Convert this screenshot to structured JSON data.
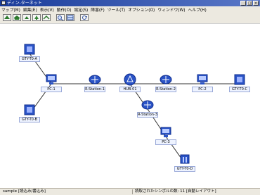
{
  "window": {
    "title": "ディン-ターネット"
  },
  "menu": [
    "マップ(M)",
    "編集(E)",
    "表示(V)",
    "動作(O)",
    "設定(S)",
    "障害(F)",
    "ツール(T)",
    "オプション(O)",
    "ウィンドウ(W)",
    "ヘルプ(H)"
  ],
  "toolbar": [
    "back-icon",
    "home-icon",
    "up-icon",
    "upup-icon",
    "link-icon",
    "zoom-icon",
    "map-icon",
    "refresh-icon"
  ],
  "nodes": [
    {
      "id": "srv1",
      "type": "server",
      "label": "GTY-T0-A"
    },
    {
      "id": "pc1",
      "type": "pc",
      "label": "PC-1"
    },
    {
      "id": "srv2",
      "type": "server",
      "label": "GTY-T0-B"
    },
    {
      "id": "rt1",
      "type": "router",
      "label": "R-Station-1"
    },
    {
      "id": "hub",
      "type": "hub",
      "label": "HUB-01"
    },
    {
      "id": "rt2",
      "type": "router",
      "label": "R-Station-2"
    },
    {
      "id": "pc2",
      "type": "pc",
      "label": "PC-2"
    },
    {
      "id": "srv3",
      "type": "server",
      "label": "GTY-T0-C"
    },
    {
      "id": "rt3",
      "type": "router",
      "label": "R-Station-3"
    },
    {
      "id": "pc3",
      "type": "pc",
      "label": "PC-3"
    },
    {
      "id": "bld1",
      "type": "building",
      "label": "GTY-T0-D"
    }
  ],
  "links": [
    [
      "srv1",
      "pc1"
    ],
    [
      "pc1",
      "srv2"
    ],
    [
      "pc1",
      "rt1"
    ],
    [
      "rt1",
      "hub"
    ],
    [
      "hub",
      "rt2"
    ],
    [
      "rt2",
      "pc2"
    ],
    [
      "pc2",
      "srv3"
    ],
    [
      "hub",
      "rt3"
    ],
    [
      "rt3",
      "pc3"
    ],
    [
      "pc3",
      "bld1"
    ]
  ],
  "status": {
    "left": "sample [読込み/書込み]",
    "right": "読取されたシンボルの数: 11 [自動レイアウト]"
  },
  "colors": {
    "title_bg": "#1a3c9a",
    "menubar_bg": "#ece9e0",
    "node_blue": "#2a53c6",
    "node_label_bg": "#eef3ff"
  }
}
